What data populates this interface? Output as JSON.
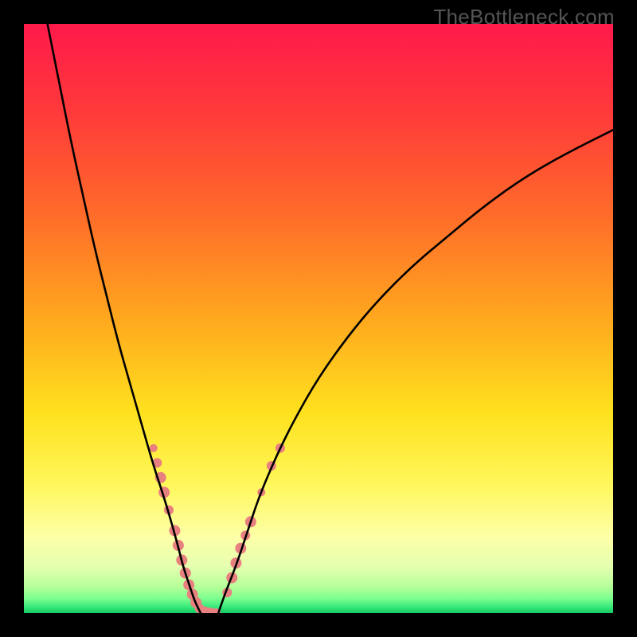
{
  "watermark": "TheBottleneck.com",
  "chart_data": {
    "type": "line",
    "title": "",
    "xlabel": "",
    "ylabel": "",
    "xlim": [
      0,
      100
    ],
    "ylim": [
      0,
      100
    ],
    "gradient_stops": [
      {
        "offset": 0.0,
        "color": "#ff1a4b"
      },
      {
        "offset": 0.15,
        "color": "#ff3a3a"
      },
      {
        "offset": 0.32,
        "color": "#ff6a2a"
      },
      {
        "offset": 0.5,
        "color": "#ffa81e"
      },
      {
        "offset": 0.66,
        "color": "#ffe11e"
      },
      {
        "offset": 0.78,
        "color": "#fff75a"
      },
      {
        "offset": 0.87,
        "color": "#fdffa6"
      },
      {
        "offset": 0.92,
        "color": "#e6ffb0"
      },
      {
        "offset": 0.955,
        "color": "#b6ff9a"
      },
      {
        "offset": 0.975,
        "color": "#7dff8f"
      },
      {
        "offset": 0.99,
        "color": "#36e77a"
      },
      {
        "offset": 1.0,
        "color": "#14c760"
      }
    ],
    "series": [
      {
        "name": "left-curve",
        "x": [
          4,
          6,
          8,
          10,
          12,
          14,
          16,
          18,
          20,
          22,
          24,
          26,
          27,
          28,
          29,
          30
        ],
        "y": [
          100,
          90,
          80,
          71,
          62,
          54,
          46,
          39,
          32,
          25,
          19,
          12,
          8,
          5,
          2,
          0
        ]
      },
      {
        "name": "right-curve",
        "x": [
          33,
          34,
          36,
          38,
          40,
          43,
          46,
          50,
          55,
          60,
          66,
          72,
          78,
          85,
          92,
          100
        ],
        "y": [
          0,
          3,
          8,
          14,
          20,
          27,
          33,
          40,
          47,
          53,
          59,
          64,
          69,
          74,
          78,
          82
        ]
      }
    ],
    "marker_clusters": [
      {
        "name": "left-markers",
        "color": "#e98080",
        "points": [
          {
            "x": 22.0,
            "y": 28.0,
            "r": 5
          },
          {
            "x": 22.6,
            "y": 25.5,
            "r": 6
          },
          {
            "x": 23.2,
            "y": 23.0,
            "r": 7
          },
          {
            "x": 23.8,
            "y": 20.5,
            "r": 7
          },
          {
            "x": 24.6,
            "y": 17.5,
            "r": 6
          },
          {
            "x": 25.6,
            "y": 14.0,
            "r": 7
          },
          {
            "x": 26.2,
            "y": 11.5,
            "r": 7
          },
          {
            "x": 26.8,
            "y": 9.0,
            "r": 7
          },
          {
            "x": 27.4,
            "y": 6.8,
            "r": 7
          },
          {
            "x": 28.0,
            "y": 4.8,
            "r": 7
          },
          {
            "x": 28.6,
            "y": 3.2,
            "r": 7
          },
          {
            "x": 29.2,
            "y": 1.8,
            "r": 7
          },
          {
            "x": 29.8,
            "y": 0.8,
            "r": 6
          },
          {
            "x": 30.6,
            "y": 0.2,
            "r": 7
          },
          {
            "x": 31.6,
            "y": 0.0,
            "r": 7
          },
          {
            "x": 32.6,
            "y": 0.0,
            "r": 6
          }
        ]
      },
      {
        "name": "right-markers",
        "color": "#e98080",
        "points": [
          {
            "x": 34.5,
            "y": 3.5,
            "r": 6
          },
          {
            "x": 35.3,
            "y": 6.0,
            "r": 7
          },
          {
            "x": 36.0,
            "y": 8.5,
            "r": 7
          },
          {
            "x": 36.8,
            "y": 11.0,
            "r": 7
          },
          {
            "x": 37.6,
            "y": 13.2,
            "r": 6
          },
          {
            "x": 38.5,
            "y": 15.5,
            "r": 7
          },
          {
            "x": 40.3,
            "y": 20.5,
            "r": 5
          },
          {
            "x": 42.0,
            "y": 25.0,
            "r": 6
          },
          {
            "x": 43.5,
            "y": 28.0,
            "r": 6
          }
        ]
      }
    ]
  }
}
